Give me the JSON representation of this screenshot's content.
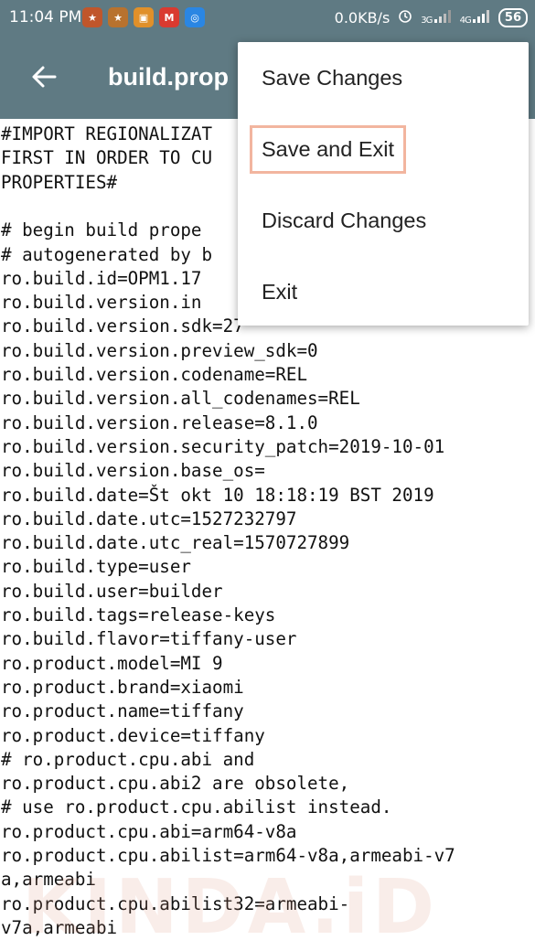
{
  "status_bar": {
    "time": "11:04 PM",
    "net_speed": "0.0KB/s",
    "net1": "3G",
    "net2": "4G",
    "battery": "56",
    "apps": [
      {
        "icon": "game-app-icon",
        "color": "#c0562b",
        "glyph": "★"
      },
      {
        "icon": "game-app-icon-2",
        "color": "#b8722e",
        "glyph": "★"
      },
      {
        "icon": "calendar-app-icon",
        "color": "#e0902a",
        "glyph": "▣"
      },
      {
        "icon": "gmail-icon",
        "color": "#d93a30",
        "glyph": "M"
      },
      {
        "icon": "blue-app-icon",
        "color": "#2a86e3",
        "glyph": "◎"
      }
    ]
  },
  "toolbar": {
    "title": "build.prop",
    "back_icon": "arrow-left-icon"
  },
  "editor": {
    "lines": [
      "#IMPORT REGIONALIZAT",
      "FIRST IN ORDER TO CU",
      "PROPERTIES#",
      "",
      "# begin build prope",
      "# autogenerated by b",
      "ro.build.id=OPM1.17",
      "ro.build.version.in",
      "ro.build.version.sdk=27",
      "ro.build.version.preview_sdk=0",
      "ro.build.version.codename=REL",
      "ro.build.version.all_codenames=REL",
      "ro.build.version.release=8.1.0",
      "ro.build.version.security_patch=2019-10-01",
      "ro.build.version.base_os=",
      "ro.build.date=Št okt 10 18:18:19 BST 2019",
      "ro.build.date.utc=1527232797",
      "ro.build.date.utc_real=1570727899",
      "ro.build.type=user",
      "ro.build.user=builder",
      "ro.build.tags=release-keys",
      "ro.build.flavor=tiffany-user",
      "ro.product.model=MI 9",
      "ro.product.brand=xiaomi",
      "ro.product.name=tiffany",
      "ro.product.device=tiffany",
      "# ro.product.cpu.abi and",
      "ro.product.cpu.abi2 are obsolete,",
      "# use ro.product.cpu.abilist instead.",
      "ro.product.cpu.abi=arm64-v8a",
      "ro.product.cpu.abilist=arm64-v8a,armeabi-v7",
      "a,armeabi",
      "ro.product.cpu.abilist32=armeabi-",
      "v7a,armeabi"
    ]
  },
  "watermark": "KINDA.iD",
  "menu": {
    "items": [
      {
        "label": "Save Changes",
        "name": "menu-save-changes"
      },
      {
        "label": "Save and Exit",
        "name": "menu-save-and-exit",
        "highlighted": true
      },
      {
        "label": "Discard Changes",
        "name": "menu-discard-changes"
      },
      {
        "label": "Exit",
        "name": "menu-exit"
      }
    ]
  }
}
